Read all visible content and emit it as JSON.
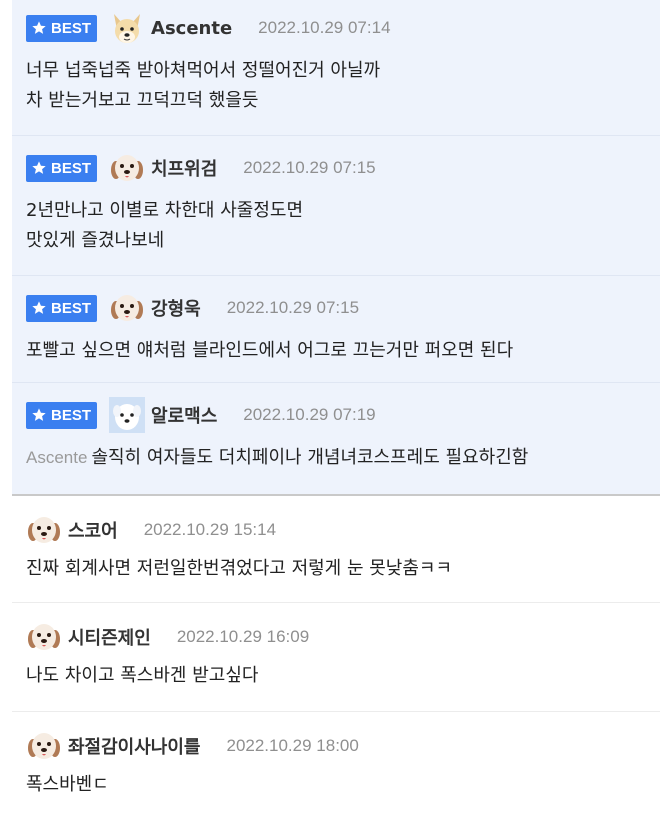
{
  "badge_label": "BEST",
  "comments": [
    {
      "author": "Ascente",
      "time": "2022.10.29 07:14",
      "avatar_icon": "cartoon-dog-avatar-icon",
      "lines": [
        "너무 넙죽넙죽 받아쳐먹어서 정떨어진거 아닐까",
        "차 받는거보고 끄덕끄덕 했을듯"
      ]
    },
    {
      "author": "치프위검",
      "time": "2022.10.29 07:15",
      "avatar_icon": "puppy-avatar-icon",
      "lines": [
        "2년만나고 이별로 차한대 사줄정도면",
        "맛있게 즐겼나보네"
      ]
    },
    {
      "author": "강형욱",
      "time": "2022.10.29 07:15",
      "avatar_icon": "puppy-avatar-icon",
      "lines": [
        "포빨고 싶으면 얘처럼 블라인드에서 어그로 끄는거만 퍼오면 된다"
      ]
    },
    {
      "author": "알로맥스",
      "time": "2022.10.29 07:19",
      "avatar_icon": "white-dog-avatar-icon",
      "mention": "Ascente",
      "lines": [
        "솔직히 여자들도 더치페이나 개념녀코스프레도 필요하긴함"
      ]
    },
    {
      "author": "스코어",
      "time": "2022.10.29 15:14",
      "avatar_icon": "puppy-avatar-icon",
      "lines": [
        "진짜 회계사면 저런일한번겪었다고 저렇게 눈 못낮춤ㅋㅋ"
      ]
    },
    {
      "author": "시티즌제인",
      "time": "2022.10.29 16:09",
      "avatar_icon": "puppy-avatar-icon",
      "lines": [
        "나도 차이고 폭스바겐 받고싶다"
      ]
    },
    {
      "author": "좌절감이사나이를",
      "time": "2022.10.29 18:00",
      "avatar_icon": "puppy-avatar-icon",
      "lines": [
        "폭스바벤ㄷ"
      ]
    }
  ]
}
